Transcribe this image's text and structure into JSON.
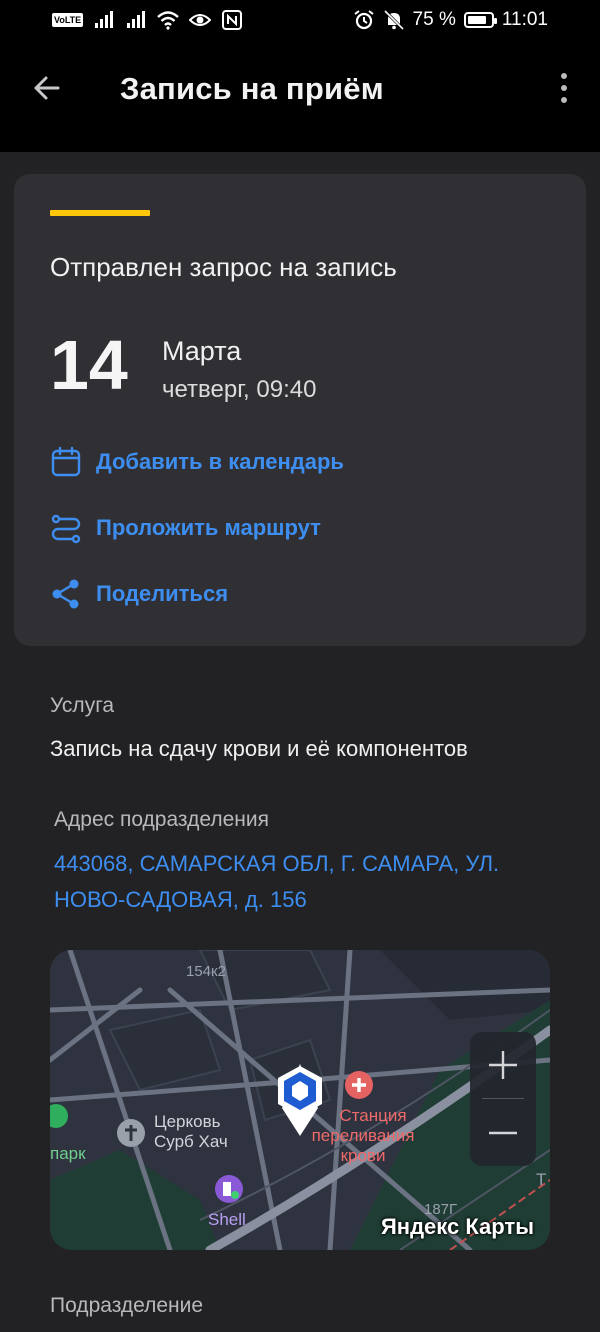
{
  "status_bar": {
    "volte": "VoLTE",
    "battery": "75 %",
    "time": "11:01"
  },
  "app_bar": {
    "title": "Запись на приём",
    "back_icon": "arrow-left-icon",
    "more_icon": "more-vertical-icon"
  },
  "appointment": {
    "status": "Отправлен запрос на запись",
    "day": "14",
    "month": "Марта",
    "weekday_time": "четверг, 09:40",
    "accent_color": "#ffc60a",
    "actions": [
      {
        "label": "Добавить в календарь",
        "icon": "calendar-icon"
      },
      {
        "label": "Проложить маршрут",
        "icon": "route-icon"
      },
      {
        "label": "Поделиться",
        "icon": "share-icon"
      }
    ]
  },
  "service": {
    "label": "Услуга",
    "value": "Запись на сдачу крови и её компонентов"
  },
  "address": {
    "label": "Адрес подразделения",
    "line1": "443068, САМАРСКАЯ ОБЛ, Г. САМАРА, УЛ.",
    "line2": "НОВО-САДОВАЯ, д. 156"
  },
  "map": {
    "labels": {
      "building_top": "154к2",
      "church_line1": "Церковь",
      "church_line2": "Сурб Хач",
      "park": "парк",
      "station_line1": "Станция",
      "station_line2": "переливания",
      "station_line3": "крови",
      "shell": "Shell",
      "building_bottom": "187Г",
      "road_t": "Т"
    },
    "brand": "Яндекс Карты",
    "zoom_in": "+",
    "zoom_out": "−"
  },
  "division": {
    "label": "Подразделение"
  },
  "colors": {
    "accent_blue": "#3d8ef0",
    "background": "#222224",
    "card": "#303034"
  }
}
